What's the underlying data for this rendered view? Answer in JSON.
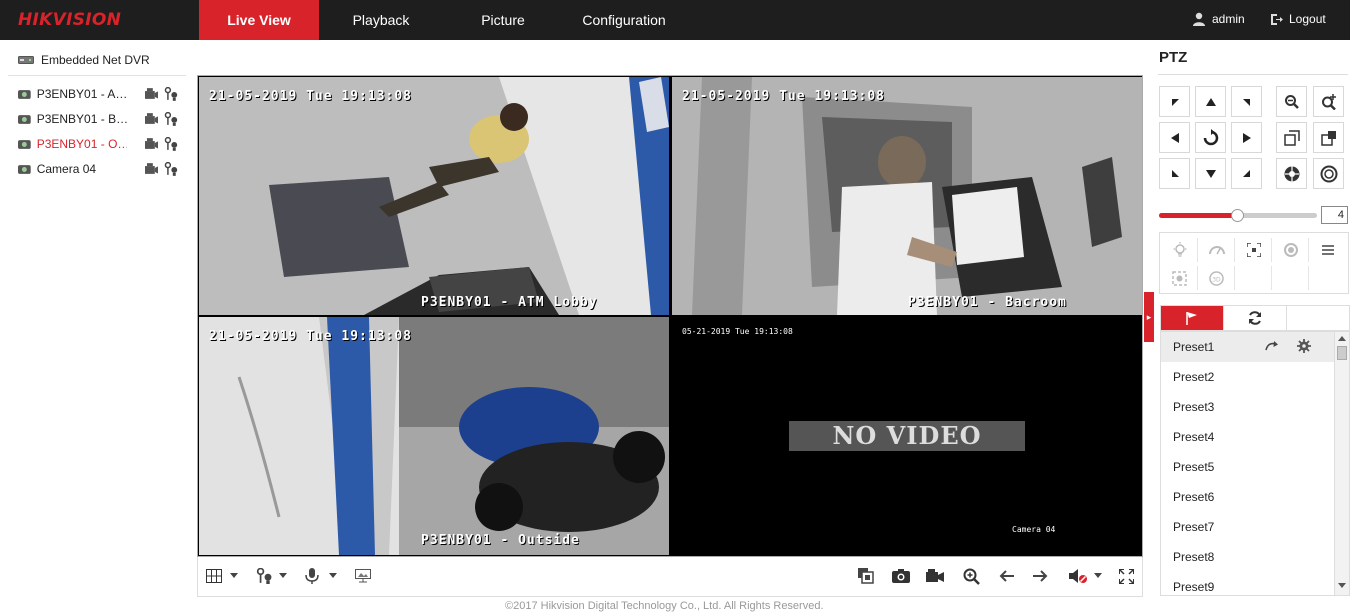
{
  "brand": "HIKVISION",
  "nav": {
    "live_view": "Live View",
    "playback": "Playback",
    "picture": "Picture",
    "configuration": "Configuration"
  },
  "user": {
    "name": "admin",
    "logout": "Logout"
  },
  "device_tree": {
    "root": "Embedded Net DVR",
    "cameras": [
      {
        "label": "P3ENBY01 - A…",
        "active": false
      },
      {
        "label": "P3ENBY01 - B…",
        "active": false
      },
      {
        "label": "P3ENBY01 - O…",
        "active": true
      },
      {
        "label": "Camera 04",
        "active": false
      }
    ]
  },
  "video": {
    "tiles": [
      {
        "timestamp": "21-05-2019 Tue 19:13:08",
        "channel": "P3ENBY01 - ATM Lobby"
      },
      {
        "timestamp": "21-05-2019 Tue 19:13:08",
        "channel": "P3ENBY01 - Bacroom"
      },
      {
        "timestamp": "21-05-2019 Tue 19:13:08",
        "channel": "P3ENBY01 - Outside"
      },
      {
        "timestamp": "05-21-2019 Tue 19:13:08",
        "channel": "Camera 04",
        "no_video": "NO VIDEO"
      }
    ]
  },
  "toolbar": {
    "icons": [
      "window-split-icon",
      "ptz-control-icon",
      "microphone-icon",
      "video-stream-icon",
      "capture-multi-icon",
      "camera-snapshot-icon",
      "record-icon",
      "digital-zoom-icon",
      "previous-page-icon",
      "next-page-icon",
      "volume-icon",
      "fullscreen-icon"
    ]
  },
  "copyright": "©2017 Hikvision Digital Technology Co., Ltd. All Rights Reserved.",
  "ptz": {
    "title": "PTZ",
    "speed": "4",
    "speed_level": 0.5,
    "presets": [
      "Preset1",
      "Preset2",
      "Preset3",
      "Preset4",
      "Preset5",
      "Preset6",
      "Preset7",
      "Preset8",
      "Preset9"
    ]
  },
  "colors": {
    "accent": "#d9232b",
    "topbar": "#1e1e1e",
    "selection": "#e8c21b"
  }
}
